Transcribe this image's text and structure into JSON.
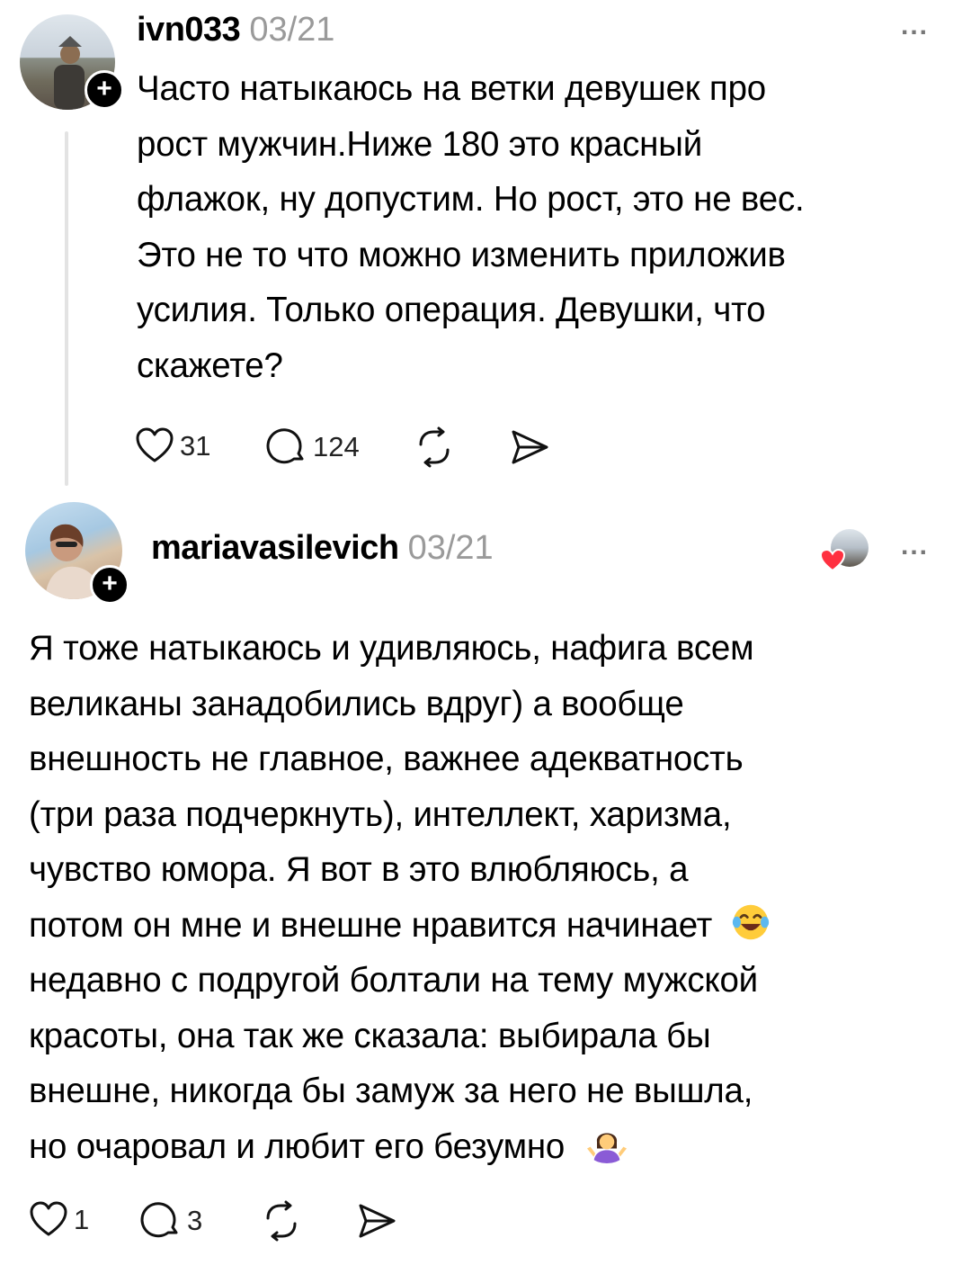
{
  "post1": {
    "username": "ivn033",
    "time": "03/21",
    "more": "...",
    "lines": [
      "Часто натыкаюсь на ветки девушек про",
      "рост мужчин.Ниже 180 это красный",
      "флажок, ну допустим. Но рост, это не вес.",
      "Это не то что можно изменить приложив",
      "усилия. Только операция. Девушки, что",
      "скажете?"
    ],
    "likes": "31",
    "replies": "124"
  },
  "post2": {
    "username": "mariavasilevich",
    "time": "03/21",
    "more": "...",
    "lines": [
      "Я тоже натыкаюсь и удивляюсь, нафига всем",
      "великаны занадобились вдруг) а вообще",
      "внешность не главное, важнее адекватность",
      "(три раза подчеркнуть), интеллект, харизма,",
      "чувство юмора. Я вот в это влюбляюсь, а",
      "потом он мне и внешне нравится начинает",
      "недавно с подругой болтали на тему мужской",
      "красоты, она так же сказала: выбирала бы",
      "внешне, никогда бы замуж за него не вышла,",
      "но очаровал и любит его безумно"
    ],
    "likes": "1",
    "replies": "3"
  },
  "icons": {
    "follow": "+",
    "like": "heart-icon",
    "reply": "comment-icon",
    "repost": "repost-icon",
    "share": "share-icon"
  }
}
